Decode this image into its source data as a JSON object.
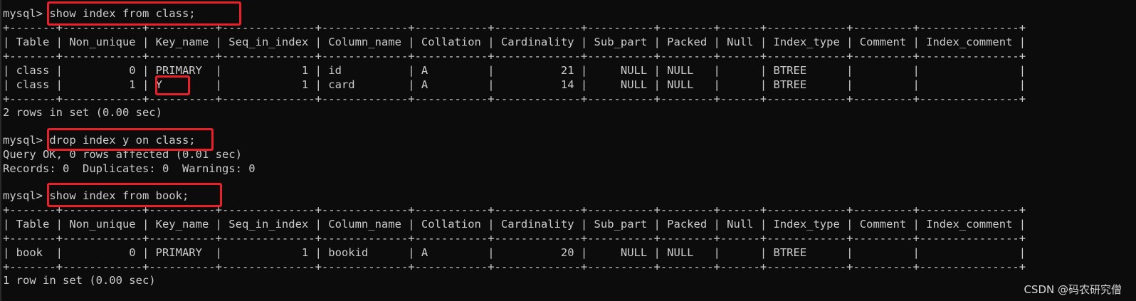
{
  "terminal": {
    "prompt": "mysql>",
    "lines": [
      "mysql> show index from class;",
      "+-------+------------+----------+--------------+-------------+-----------+-------------+----------+--------+------+------------+---------+---------------+",
      "| Table | Non_unique | Key_name | Seq_in_index | Column_name | Collation | Cardinality | Sub_part | Packed | Null | Index_type | Comment | Index_comment |",
      "+-------+------------+----------+--------------+-------------+-----------+-------------+----------+--------+------+------------+---------+---------------+",
      "| class |          0 | PRIMARY  |            1 | id          | A         |          21 |     NULL | NULL   |      | BTREE      |         |               |",
      "| class |          1 | Y        |            1 | card        | A         |          14 |     NULL | NULL   |      | BTREE      |         |               |",
      "+-------+------------+----------+--------------+-------------+-----------+-------------+----------+--------+------+------------+---------+---------------+",
      "2 rows in set (0.00 sec)",
      "",
      "mysql> drop index y on class;",
      "Query OK, 0 rows affected (0.01 sec)",
      "Records: 0  Duplicates: 0  Warnings: 0",
      "",
      "mysql> show index from book;",
      "+-------+------------+----------+--------------+-------------+-----------+-------------+----------+--------+------+------------+---------+---------------+",
      "| Table | Non_unique | Key_name | Seq_in_index | Column_name | Collation | Cardinality | Sub_part | Packed | Null | Index_type | Comment | Index_comment |",
      "+-------+------------+----------+--------------+-------------+-----------+-------------+----------+--------+------+------------+---------+---------------+",
      "| book  |          0 | PRIMARY  |            1 | bookid      | A         |          20 |     NULL | NULL   |      | BTREE      |         |               |",
      "+-------+------------+----------+--------------+-------------+-----------+-------------+----------+--------+------+------------+---------+---------------+",
      "1 row in set (0.00 sec)"
    ]
  },
  "watermark": "CSDN @码农研究僧",
  "colors": {
    "background": "#0c0c0c",
    "text": "#cccccc",
    "highlight": "#e8202a"
  }
}
